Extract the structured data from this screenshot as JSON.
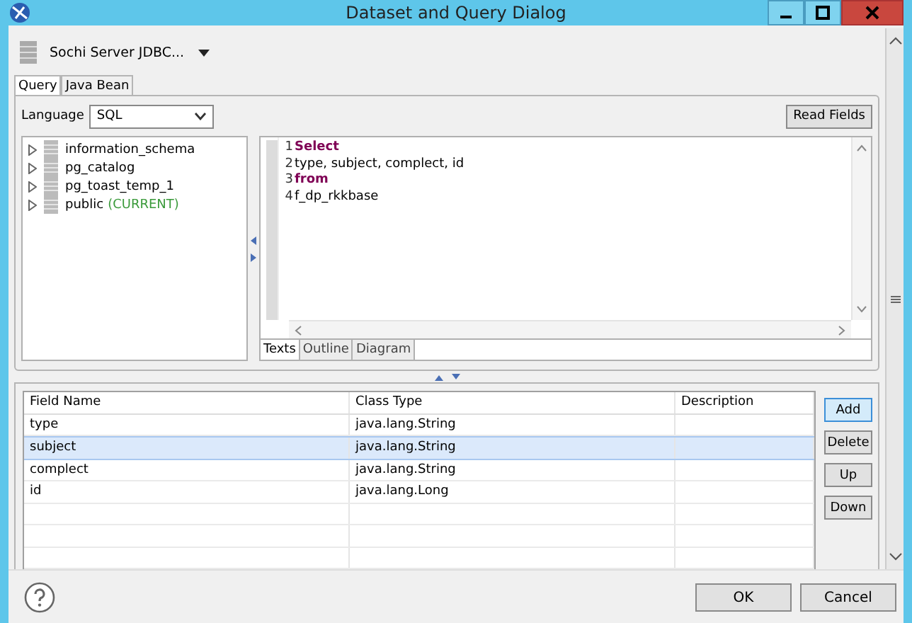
{
  "window": {
    "title": "Dataset and Query Dialog"
  },
  "data_source": {
    "label": "Sochi Server JDBC..."
  },
  "tabs": [
    {
      "label": "Query",
      "selected": true
    },
    {
      "label": "Java Bean",
      "selected": false
    }
  ],
  "language": {
    "label": "Language",
    "value": "SQL"
  },
  "read_fields_button": "Read Fields",
  "tree": [
    {
      "label": "information_schema"
    },
    {
      "label": "pg_catalog"
    },
    {
      "label": "pg_toast_temp_1"
    },
    {
      "label": "public",
      "note": "(CURRENT)"
    }
  ],
  "editor_lines": [
    {
      "number": "1",
      "text": "Select",
      "kind": "keyword"
    },
    {
      "number": "2",
      "text": "type, subject, complect, id",
      "kind": "plain"
    },
    {
      "number": "3",
      "text": "from",
      "kind": "keyword"
    },
    {
      "number": "4",
      "text": "f_dp_rkkbase",
      "kind": "plain"
    }
  ],
  "editor_tabs": [
    {
      "label": "Texts",
      "selected": true
    },
    {
      "label": "Outline",
      "selected": false
    },
    {
      "label": "Diagram",
      "selected": false
    }
  ],
  "table": {
    "columns": [
      "Field Name",
      "Class Type",
      "Description"
    ],
    "rows": [
      {
        "cells": [
          "type",
          "java.lang.String",
          ""
        ],
        "selected": false
      },
      {
        "cells": [
          "subject",
          "java.lang.String",
          ""
        ],
        "selected": true
      },
      {
        "cells": [
          "complect",
          "java.lang.String",
          ""
        ],
        "selected": false
      },
      {
        "cells": [
          "id",
          "java.lang.Long",
          ""
        ],
        "selected": false
      }
    ]
  },
  "side_buttons": [
    {
      "label": "Add",
      "focused": true
    },
    {
      "label": "Delete",
      "focused": false
    },
    {
      "label": "Up",
      "focused": false
    },
    {
      "label": "Down",
      "focused": false
    }
  ],
  "footer_buttons": [
    "OK",
    "Cancel"
  ]
}
